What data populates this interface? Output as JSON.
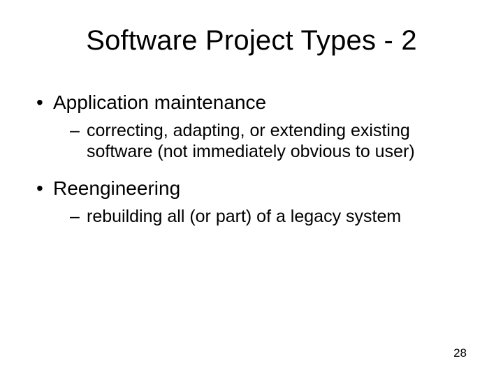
{
  "title": "Software Project Types - 2",
  "bullets": [
    {
      "label": "Application maintenance",
      "sub": [
        "correcting, adapting, or extending existing software (not immediately obvious to user)"
      ]
    },
    {
      "label": "Reengineering",
      "sub": [
        "rebuilding all (or part) of a legacy system"
      ]
    }
  ],
  "page_number": "28"
}
